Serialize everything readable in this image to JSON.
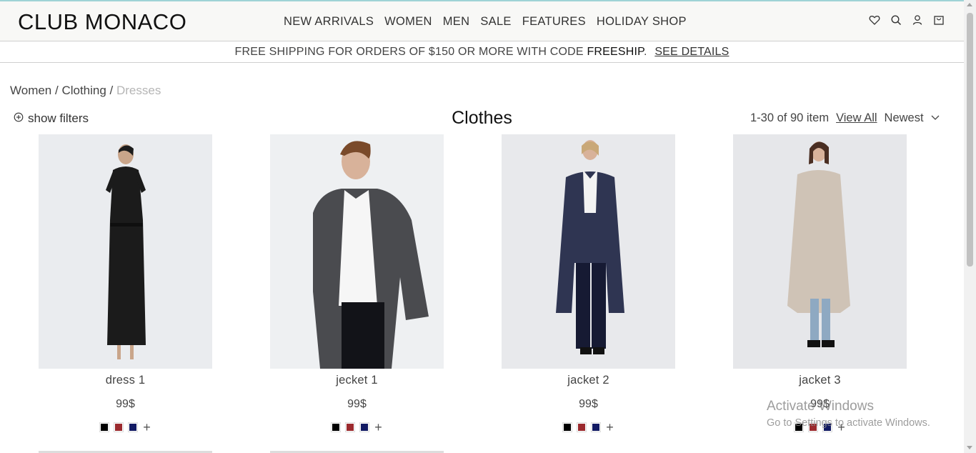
{
  "brand": {
    "logo": "CLUB MONACO"
  },
  "nav": [
    "NEW ARRIVALS",
    "WOMEN",
    "MEN",
    "SALE",
    "FEATURES",
    "HOLIDAY SHOP"
  ],
  "header_icons": [
    "heart-icon",
    "search-icon",
    "user-icon",
    "bag-icon"
  ],
  "promo": {
    "text": "FREE SHIPPING FOR ORDERS OF $150 OR MORE WITH CODE ",
    "code": "FREESHIP",
    "suffix": ".",
    "link": "SEE DETAILS"
  },
  "breadcrumb": {
    "items": [
      "Women",
      "Clothing"
    ],
    "separator": " / ",
    "current": "Dresses"
  },
  "toolbar": {
    "filters_label": "show filters",
    "page_title": "Clothes",
    "count": "1-30 of 90 item",
    "view_all": "View All",
    "sort": "Newest"
  },
  "products": [
    {
      "name": "dress 1",
      "price": "99$",
      "swatches": [
        "#000000",
        "#9b2a2e",
        "#121a63"
      ],
      "more": "+"
    },
    {
      "name": "jecket 1",
      "price": "99$",
      "swatches": [
        "#000000",
        "#9b2a2e",
        "#121a63"
      ],
      "more": "+"
    },
    {
      "name": "jacket 2",
      "price": "99$",
      "swatches": [
        "#000000",
        "#9b2a2e",
        "#121a63"
      ],
      "more": "+"
    },
    {
      "name": "jacket 3",
      "price": "99$",
      "swatches": [
        "#000000",
        "#9b2a2e",
        "#121a63"
      ],
      "more": "+"
    }
  ],
  "watermark": {
    "title": "Activate Windows",
    "subtitle": "Go to Settings to activate Windows."
  },
  "colors": {
    "accent_topline": "#9fd3d6",
    "header_bg": "#f8f8f6",
    "breadcrumb_current": "#b5b5b5"
  }
}
